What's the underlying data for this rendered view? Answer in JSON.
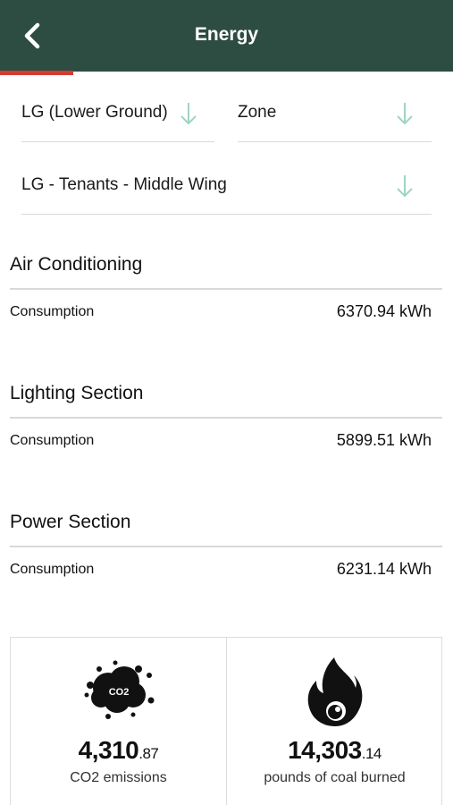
{
  "header": {
    "title": "Energy"
  },
  "filters": {
    "floor": "LG (Lower Ground)",
    "zone": "Zone",
    "area": "LG - Tenants - Middle Wing"
  },
  "sections": [
    {
      "title": "Air Conditioning",
      "label": "Consumption",
      "value": "6370.94 kWh"
    },
    {
      "title": "Lighting Section",
      "label": "Consumption",
      "value": "5899.51 kWh"
    },
    {
      "title": "Power Section",
      "label": "Consumption",
      "value": "6231.14 kWh"
    }
  ],
  "stats": {
    "co2": {
      "icon_text": "CO2",
      "value_main": "4,310",
      "value_decimal": ".87",
      "caption": "CO2 emissions"
    },
    "coal": {
      "value_main": "14,303",
      "value_decimal": ".14",
      "caption": "pounds of coal burned"
    }
  },
  "colors": {
    "header_bg": "#2d4c42",
    "progress_accent": "#d23c34",
    "arrow": "#9fd4c2"
  },
  "icons": {
    "back": "chevron-left-icon",
    "dropdown": "arrow-down-icon",
    "co2": "co2-cloud-icon",
    "coal": "flame-icon"
  }
}
